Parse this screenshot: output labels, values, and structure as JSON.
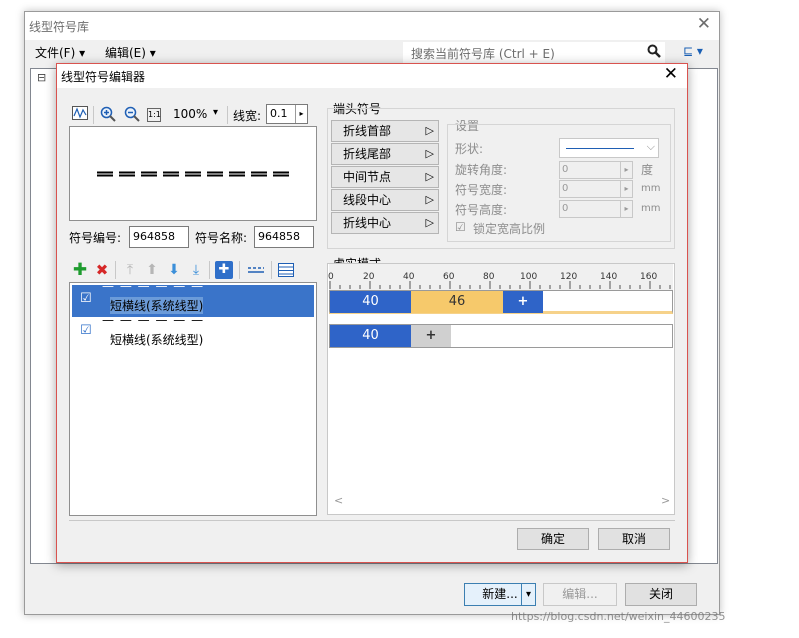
{
  "outer_window": {
    "title": "线型符号库",
    "close_glyph": "✕",
    "menu": {
      "file": "文件(F) ▾",
      "edit": "编辑(E) ▾"
    },
    "search_placeholder": "搜索当前符号库 (Ctrl + E)",
    "view_button": "⊑ ▾",
    "tree_glyph": "⊟",
    "buttons": {
      "new": "新建...",
      "new_dropdown": "▾",
      "edit": "编辑...",
      "close": "关闭"
    },
    "watermark": "https://blog.csdn.net/weixin_44600235"
  },
  "dialog": {
    "title": "线型符号编辑器",
    "close_glyph": "✕",
    "toolbar": {
      "zoom_value": "100%",
      "zoom_arrow": "▾",
      "line_width_label": "线宽:",
      "line_width_value": "0.1",
      "spin_arrow": "▸",
      "ratio_icon": "1:1"
    },
    "symbol_no_label": "符号编号:",
    "symbol_no_value": "964858",
    "symbol_name_label": "符号名称:",
    "symbol_name_value": "964858",
    "layers": [
      {
        "check": "☑",
        "dashes": "—  —  —  —  —  —",
        "name": "短横线(系统线型)",
        "selected": true
      },
      {
        "check": "☑",
        "dashes": "—  —  —  —  —  —",
        "name": "短横线(系统线型)",
        "selected": false
      }
    ],
    "endpoint": {
      "title": "端头符号",
      "buttons": [
        "折线首部",
        "折线尾部",
        "中间节点",
        "线段中心",
        "折线中心"
      ],
      "arrow": "▷",
      "settings_title": "设置",
      "shape_label": "形状:",
      "rotate_label": "旋转角度:",
      "rotate_value": "0",
      "rotate_unit": "度",
      "width_label": "符号宽度:",
      "width_value": "0",
      "width_unit": "mm",
      "height_label": "符号高度:",
      "height_value": "0",
      "height_unit": "mm",
      "lock_check": "☑",
      "lock_label": "锁定宽高比例",
      "dropdown_arrow": "⌵",
      "spin_arrow": "▸"
    },
    "dash_pattern": {
      "title": "虚实模式",
      "ruler_ticks": [
        "0",
        "20",
        "40",
        "60",
        "80",
        "100",
        "120",
        "140",
        "160"
      ],
      "row1": {
        "solid": "40",
        "gap": "46",
        "add": "+"
      },
      "row2": {
        "solid": "40",
        "add": "+"
      },
      "scroll_left": "<",
      "scroll_right": ">"
    },
    "buttons": {
      "ok": "确定",
      "cancel": "取消"
    }
  },
  "colors": {
    "selection_blue": "#3a74c9",
    "segment_blue": "#2f64c8",
    "segment_orange": "#f6c96b",
    "dialog_border": "#d9534f"
  }
}
